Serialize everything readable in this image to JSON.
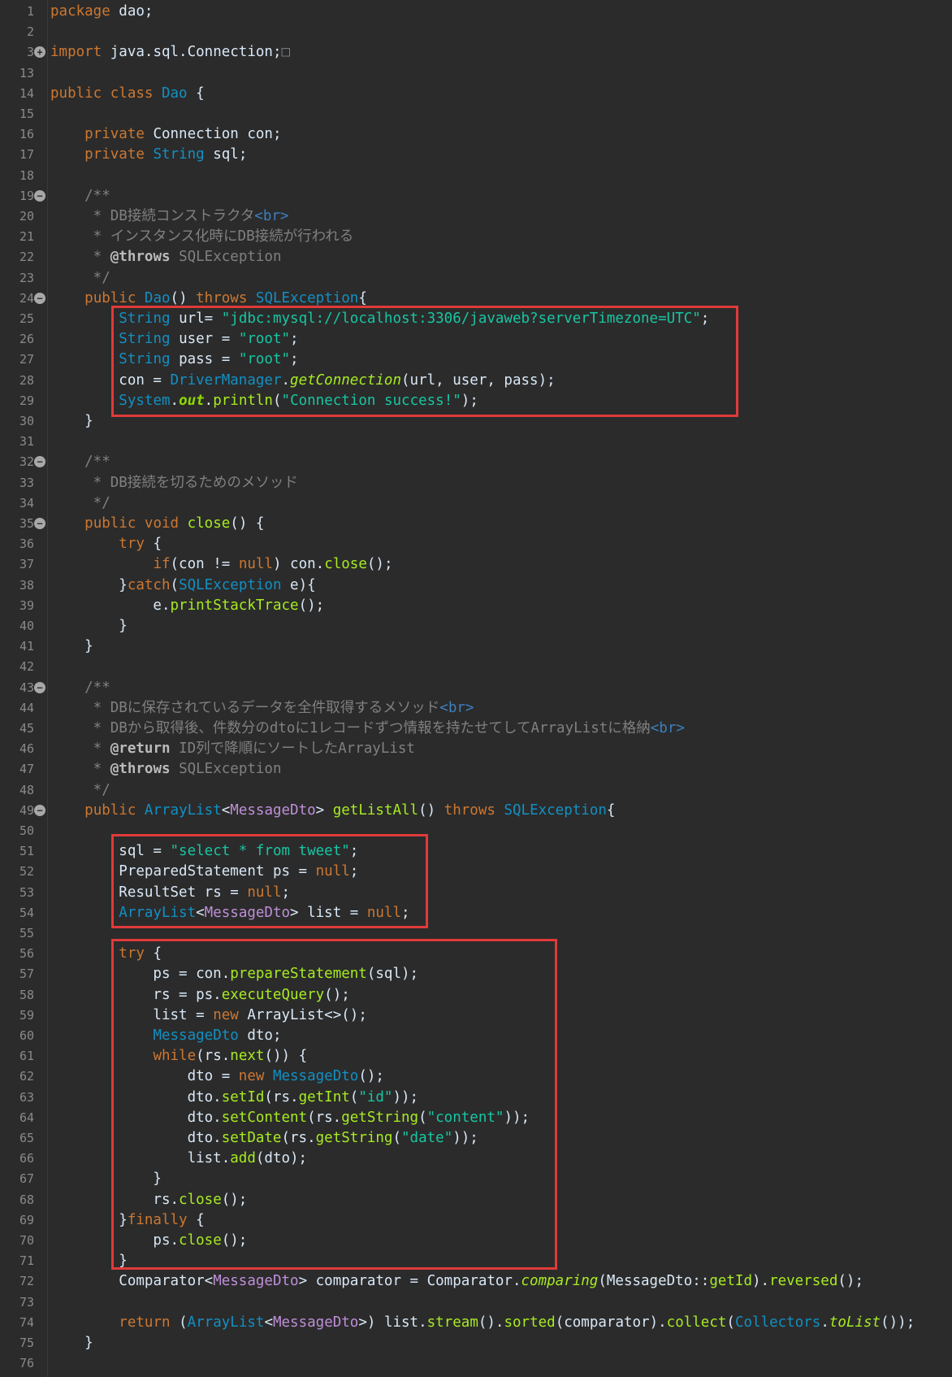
{
  "editor": {
    "lines": [
      {
        "n": "1",
        "parts": [
          [
            "kw",
            "package "
          ],
          [
            "",
            "dao;"
          ]
        ]
      },
      {
        "n": "2",
        "parts": []
      },
      {
        "n": "3",
        "fold": "+",
        "parts": [
          [
            "kw",
            "import "
          ],
          [
            "",
            "java.sql.Connection;"
          ],
          [
            "cm",
            "□"
          ]
        ]
      },
      {
        "n": "13",
        "parts": []
      },
      {
        "n": "14",
        "parts": [
          [
            "kw",
            "public class "
          ],
          [
            "ty",
            "Dao"
          ],
          [
            "",
            " {"
          ]
        ]
      },
      {
        "n": "15",
        "parts": []
      },
      {
        "n": "16",
        "parts": [
          [
            "",
            "    "
          ],
          [
            "kw",
            "private "
          ],
          [
            "ty2",
            "Connection "
          ],
          [
            "",
            "con;"
          ]
        ]
      },
      {
        "n": "17",
        "parts": [
          [
            "",
            "    "
          ],
          [
            "kw",
            "private "
          ],
          [
            "ty",
            "String "
          ],
          [
            "",
            "sql;"
          ]
        ]
      },
      {
        "n": "18",
        "parts": []
      },
      {
        "n": "19",
        "fold": "-",
        "parts": [
          [
            "cm",
            "    /**"
          ]
        ]
      },
      {
        "n": "20",
        "parts": [
          [
            "cm",
            "     * DB接続コンストラクタ"
          ],
          [
            "tag",
            "<br>"
          ]
        ]
      },
      {
        "n": "21",
        "parts": [
          [
            "cm",
            "     * インスタンス化時にDB接続が行われる"
          ]
        ]
      },
      {
        "n": "22",
        "parts": [
          [
            "cm",
            "     * "
          ],
          [
            "ann",
            "@throws"
          ],
          [
            "cm",
            " SQLException"
          ]
        ]
      },
      {
        "n": "23",
        "parts": [
          [
            "cm",
            "     */"
          ]
        ]
      },
      {
        "n": "24",
        "fold": "-",
        "parts": [
          [
            "",
            "    "
          ],
          [
            "kw",
            "public "
          ],
          [
            "ty",
            "Dao"
          ],
          [
            "",
            "() "
          ],
          [
            "kw",
            "throws "
          ],
          [
            "ty",
            "SQLException"
          ],
          [
            "",
            "{"
          ]
        ]
      },
      {
        "n": "25",
        "parts": [
          [
            "",
            "        "
          ],
          [
            "ty",
            "String "
          ],
          [
            "",
            "url= "
          ],
          [
            "str",
            "\"jdbc:mysql://localhost:3306/javaweb?serverTimezone=UTC\""
          ],
          [
            "",
            ";"
          ]
        ]
      },
      {
        "n": "26",
        "parts": [
          [
            "",
            "        "
          ],
          [
            "ty",
            "String "
          ],
          [
            "",
            "user = "
          ],
          [
            "str",
            "\"root\""
          ],
          [
            "",
            ";"
          ]
        ]
      },
      {
        "n": "27",
        "parts": [
          [
            "",
            "        "
          ],
          [
            "ty",
            "String "
          ],
          [
            "",
            "pass = "
          ],
          [
            "str",
            "\"root\""
          ],
          [
            "",
            ";"
          ]
        ]
      },
      {
        "n": "28",
        "parts": [
          [
            "",
            "        con = "
          ],
          [
            "ty",
            "DriverManager"
          ],
          [
            "",
            "."
          ],
          [
            "ital",
            "getConnection"
          ],
          [
            "",
            "(url, user, pass);"
          ]
        ]
      },
      {
        "n": "29",
        "parts": [
          [
            "",
            "        "
          ],
          [
            "ty",
            "System"
          ],
          [
            "",
            "."
          ],
          [
            "static",
            "out"
          ],
          [
            "",
            "."
          ],
          [
            "method",
            "println"
          ],
          [
            "",
            "("
          ],
          [
            "str",
            "\"Connection success!\""
          ],
          [
            "",
            ");"
          ]
        ]
      },
      {
        "n": "30",
        "parts": [
          [
            "",
            "    }"
          ]
        ]
      },
      {
        "n": "31",
        "parts": []
      },
      {
        "n": "32",
        "fold": "-",
        "parts": [
          [
            "cm",
            "    /**"
          ]
        ]
      },
      {
        "n": "33",
        "parts": [
          [
            "cm",
            "     * DB接続を切るためのメソッド"
          ]
        ]
      },
      {
        "n": "34",
        "parts": [
          [
            "cm",
            "     */"
          ]
        ]
      },
      {
        "n": "35",
        "fold": "-",
        "parts": [
          [
            "",
            "    "
          ],
          [
            "kw",
            "public void "
          ],
          [
            "method",
            "close"
          ],
          [
            "",
            "() {"
          ]
        ]
      },
      {
        "n": "36",
        "parts": [
          [
            "",
            "        "
          ],
          [
            "kw",
            "try"
          ],
          [
            "",
            " {"
          ]
        ]
      },
      {
        "n": "37",
        "parts": [
          [
            "",
            "            "
          ],
          [
            "kw",
            "if"
          ],
          [
            "",
            "(con != "
          ],
          [
            "kw",
            "null"
          ],
          [
            "",
            ") con."
          ],
          [
            "method",
            "close"
          ],
          [
            "",
            "();"
          ]
        ]
      },
      {
        "n": "38",
        "parts": [
          [
            "",
            "        }"
          ],
          [
            "kw",
            "catch"
          ],
          [
            "",
            "("
          ],
          [
            "ty",
            "SQLException"
          ],
          [
            "",
            " e){"
          ]
        ]
      },
      {
        "n": "39",
        "parts": [
          [
            "",
            "            e."
          ],
          [
            "method",
            "printStackTrace"
          ],
          [
            "",
            "();"
          ]
        ]
      },
      {
        "n": "40",
        "parts": [
          [
            "",
            "        }"
          ]
        ]
      },
      {
        "n": "41",
        "parts": [
          [
            "",
            "    }"
          ]
        ]
      },
      {
        "n": "42",
        "parts": []
      },
      {
        "n": "43",
        "fold": "-",
        "parts": [
          [
            "cm",
            "    /**"
          ]
        ]
      },
      {
        "n": "44",
        "parts": [
          [
            "cm",
            "     * DBに保存されているデータを全件取得するメソッド"
          ],
          [
            "tag",
            "<br>"
          ]
        ]
      },
      {
        "n": "45",
        "parts": [
          [
            "cm",
            "     * DBから取得後、件数分のdtoに1レコードずつ情報を持たせてしてArrayListに格納"
          ],
          [
            "tag",
            "<br>"
          ]
        ]
      },
      {
        "n": "46",
        "parts": [
          [
            "cm",
            "     * "
          ],
          [
            "ann",
            "@return"
          ],
          [
            "cm",
            " ID列で降順にソートしたArrayList"
          ]
        ]
      },
      {
        "n": "47",
        "parts": [
          [
            "cm",
            "     * "
          ],
          [
            "ann",
            "@throws"
          ],
          [
            "cm",
            " SQLException"
          ]
        ]
      },
      {
        "n": "48",
        "parts": [
          [
            "cm",
            "     */"
          ]
        ]
      },
      {
        "n": "49",
        "fold": "-",
        "parts": [
          [
            "",
            "    "
          ],
          [
            "kw",
            "public "
          ],
          [
            "ty",
            "ArrayList"
          ],
          [
            "",
            "<"
          ],
          [
            "gen",
            "MessageDto"
          ],
          [
            "",
            "> "
          ],
          [
            "method",
            "getListAll"
          ],
          [
            "",
            "() "
          ],
          [
            "kw",
            "throws "
          ],
          [
            "ty",
            "SQLException"
          ],
          [
            "",
            "{"
          ]
        ]
      },
      {
        "n": "50",
        "parts": []
      },
      {
        "n": "51",
        "parts": [
          [
            "",
            "        sql = "
          ],
          [
            "str",
            "\"select * from tweet\""
          ],
          [
            "",
            ";"
          ]
        ]
      },
      {
        "n": "52",
        "parts": [
          [
            "",
            "        "
          ],
          [
            "ty2",
            "PreparedStatement "
          ],
          [
            "",
            "ps = "
          ],
          [
            "kw",
            "null"
          ],
          [
            "",
            ";"
          ]
        ]
      },
      {
        "n": "53",
        "parts": [
          [
            "",
            "        "
          ],
          [
            "ty2",
            "ResultSet "
          ],
          [
            "",
            "rs = "
          ],
          [
            "kw",
            "null"
          ],
          [
            "",
            ";"
          ]
        ]
      },
      {
        "n": "54",
        "parts": [
          [
            "",
            "        "
          ],
          [
            "ty",
            "ArrayList"
          ],
          [
            "",
            "<"
          ],
          [
            "gen",
            "MessageDto"
          ],
          [
            "",
            "> list = "
          ],
          [
            "kw",
            "null"
          ],
          [
            "",
            ";"
          ]
        ]
      },
      {
        "n": "55",
        "parts": []
      },
      {
        "n": "56",
        "parts": [
          [
            "",
            "        "
          ],
          [
            "kw",
            "try"
          ],
          [
            "",
            " {"
          ]
        ]
      },
      {
        "n": "57",
        "parts": [
          [
            "",
            "            ps = con."
          ],
          [
            "method",
            "prepareStatement"
          ],
          [
            "",
            "(sql);"
          ]
        ]
      },
      {
        "n": "58",
        "parts": [
          [
            "",
            "            rs = ps."
          ],
          [
            "method",
            "executeQuery"
          ],
          [
            "",
            "();"
          ]
        ]
      },
      {
        "n": "59",
        "parts": [
          [
            "",
            "            list = "
          ],
          [
            "kw",
            "new "
          ],
          [
            "ty2",
            "ArrayList"
          ],
          [
            "",
            "<>();"
          ]
        ]
      },
      {
        "n": "60",
        "parts": [
          [
            "",
            "            "
          ],
          [
            "ty",
            "MessageDto "
          ],
          [
            "",
            "dto;"
          ]
        ]
      },
      {
        "n": "61",
        "parts": [
          [
            "",
            "            "
          ],
          [
            "kw",
            "while"
          ],
          [
            "",
            "(rs."
          ],
          [
            "method",
            "next"
          ],
          [
            "",
            "()) {"
          ]
        ]
      },
      {
        "n": "62",
        "parts": [
          [
            "",
            "                dto = "
          ],
          [
            "kw",
            "new "
          ],
          [
            "ty",
            "MessageDto"
          ],
          [
            "",
            "();"
          ]
        ]
      },
      {
        "n": "63",
        "parts": [
          [
            "",
            "                dto."
          ],
          [
            "method",
            "setId"
          ],
          [
            "",
            "(rs."
          ],
          [
            "method",
            "getInt"
          ],
          [
            "",
            "("
          ],
          [
            "str",
            "\"id\""
          ],
          [
            "",
            "));"
          ]
        ]
      },
      {
        "n": "64",
        "parts": [
          [
            "",
            "                dto."
          ],
          [
            "method",
            "setContent"
          ],
          [
            "",
            "(rs."
          ],
          [
            "method",
            "getString"
          ],
          [
            "",
            "("
          ],
          [
            "str",
            "\"content\""
          ],
          [
            "",
            "));"
          ]
        ]
      },
      {
        "n": "65",
        "parts": [
          [
            "",
            "                dto."
          ],
          [
            "method",
            "setDate"
          ],
          [
            "",
            "(rs."
          ],
          [
            "method",
            "getString"
          ],
          [
            "",
            "("
          ],
          [
            "str",
            "\"date\""
          ],
          [
            "",
            "));"
          ]
        ]
      },
      {
        "n": "66",
        "parts": [
          [
            "",
            "                list."
          ],
          [
            "method",
            "add"
          ],
          [
            "",
            "(dto);"
          ]
        ]
      },
      {
        "n": "67",
        "parts": [
          [
            "",
            "            }"
          ]
        ]
      },
      {
        "n": "68",
        "parts": [
          [
            "",
            "            rs."
          ],
          [
            "method",
            "close"
          ],
          [
            "",
            "();"
          ]
        ]
      },
      {
        "n": "69",
        "parts": [
          [
            "",
            "        }"
          ],
          [
            "kw",
            "finally"
          ],
          [
            "",
            " {"
          ]
        ]
      },
      {
        "n": "70",
        "parts": [
          [
            "",
            "            ps."
          ],
          [
            "method",
            "close"
          ],
          [
            "",
            "();"
          ]
        ]
      },
      {
        "n": "71",
        "parts": [
          [
            "",
            "        }"
          ]
        ]
      },
      {
        "n": "72",
        "parts": [
          [
            "",
            "        "
          ],
          [
            "ty2",
            "Comparator"
          ],
          [
            "",
            "<"
          ],
          [
            "gen",
            "MessageDto"
          ],
          [
            "",
            "> comparator = "
          ],
          [
            "ty2",
            "Comparator"
          ],
          [
            "",
            "."
          ],
          [
            "ital",
            "comparing"
          ],
          [
            "",
            "(MessageDto::"
          ],
          [
            "method",
            "getId"
          ],
          [
            "",
            ")."
          ],
          [
            "method",
            "reversed"
          ],
          [
            "",
            "();"
          ]
        ]
      },
      {
        "n": "73",
        "parts": []
      },
      {
        "n": "74",
        "parts": [
          [
            "",
            "        "
          ],
          [
            "kw",
            "return "
          ],
          [
            "",
            "("
          ],
          [
            "ty",
            "ArrayList"
          ],
          [
            "",
            "<"
          ],
          [
            "gen",
            "MessageDto"
          ],
          [
            "",
            ">) list."
          ],
          [
            "method",
            "stream"
          ],
          [
            "",
            "()."
          ],
          [
            "method",
            "sorted"
          ],
          [
            "",
            "(comparator)."
          ],
          [
            "method",
            "collect"
          ],
          [
            "",
            "("
          ],
          [
            "ty",
            "Collectors"
          ],
          [
            "",
            "."
          ],
          [
            "ital",
            "toList"
          ],
          [
            "",
            "());"
          ]
        ]
      },
      {
        "n": "75",
        "parts": [
          [
            "",
            "    }"
          ]
        ]
      },
      {
        "n": "76",
        "parts": []
      }
    ]
  }
}
